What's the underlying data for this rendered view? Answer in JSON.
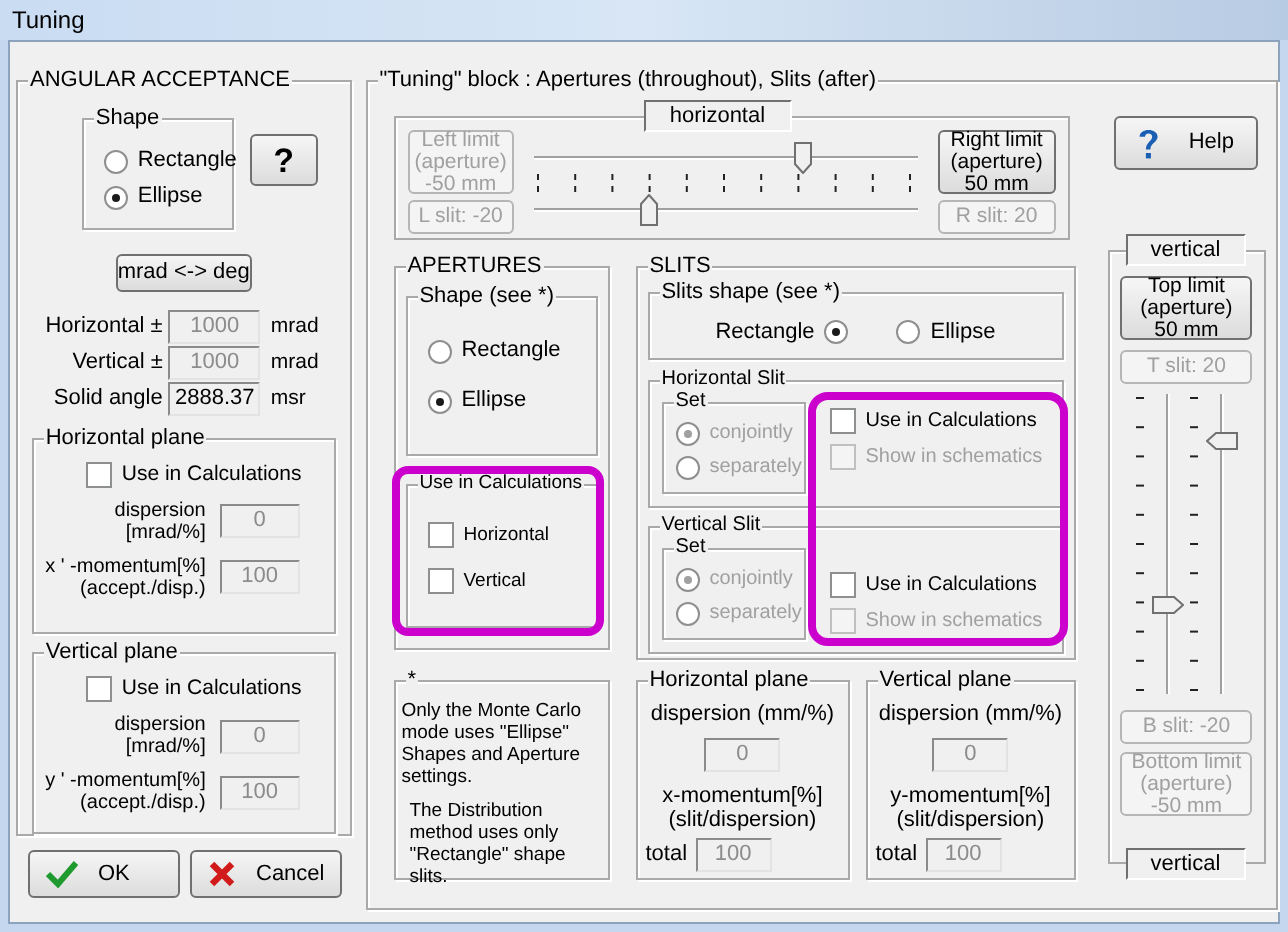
{
  "window": {
    "title": "Tuning"
  },
  "angular_acceptance": {
    "title": "ANGULAR ACCEPTANCE",
    "shape": {
      "title": "Shape",
      "options": [
        {
          "label": "Rectangle",
          "selected": false
        },
        {
          "label": "Ellipse",
          "selected": true
        }
      ]
    },
    "help_button": "?",
    "convert_button": "mrad <-> deg",
    "fields": [
      {
        "label": "Horizontal ±",
        "value": "1000",
        "unit": "mrad",
        "disabled": true
      },
      {
        "label": "Vertical ±",
        "value": "1000",
        "unit": "mrad",
        "disabled": true
      },
      {
        "label": "Solid angle",
        "value": "2888.37",
        "unit": "msr",
        "disabled": false
      }
    ],
    "planes": [
      {
        "title": "Horizontal plane",
        "checkbox": {
          "label": "Use in Calculations",
          "checked": false
        },
        "rows": [
          {
            "label": [
              "dispersion",
              "[mrad/%]"
            ],
            "value": "0",
            "disabled": true
          },
          {
            "label": [
              "x ' -momentum[%]",
              "(accept./disp.)"
            ],
            "value": "100",
            "disabled": true
          }
        ]
      },
      {
        "title": "Vertical plane",
        "checkbox": {
          "label": "Use in Calculations",
          "checked": false
        },
        "rows": [
          {
            "label": [
              "dispersion",
              "[mrad/%]"
            ],
            "value": "0",
            "disabled": true
          },
          {
            "label": [
              "y ' -momentum[%]",
              "(accept./disp.)"
            ],
            "value": "100",
            "disabled": true
          }
        ]
      }
    ]
  },
  "buttons": [
    {
      "kind": "ok",
      "label": "OK"
    },
    {
      "kind": "cancel",
      "label": "Cancel"
    }
  ],
  "tuning_block": {
    "title": "\"Tuning\" block : Apertures (throughout), Slits (after)",
    "horizontal": {
      "caption": "horizontal",
      "limit_low": {
        "lines": [
          "Left limit",
          "(aperture)",
          "-50 mm"
        ],
        "disabled": true
      },
      "slit_low": {
        "label": "L slit: -20",
        "disabled": true
      },
      "limit_high": {
        "lines": [
          "Right limit",
          "(aperture)",
          "50 mm"
        ],
        "disabled": false
      },
      "slit_high": {
        "label": "R slit: 20",
        "disabled": true
      },
      "aperture_slider": {
        "level": 0.7
      },
      "slit_slider": {
        "level": 0.3
      }
    },
    "help_button": "Help",
    "vertical": {
      "caption_top": "vertical",
      "limit_high": {
        "lines": [
          "Top limit",
          "(aperture)",
          "50 mm"
        ],
        "disabled": false
      },
      "slit_high": {
        "label": "T slit: 20",
        "disabled": true
      },
      "slit_slider": {
        "level": 0.3
      },
      "aperture_slider": {
        "level": 0.85
      },
      "slit_low": {
        "label": "B slit: -20",
        "disabled": true
      },
      "limit_low": {
        "lines": [
          "Bottom limit",
          "(aperture)",
          "-50 mm"
        ],
        "disabled": true
      },
      "caption_bottom": "vertical"
    },
    "apertures": {
      "title": "APERTURES",
      "shape": {
        "title": "Shape (see *)",
        "options": [
          {
            "label": "Rectangle",
            "selected": false
          },
          {
            "label": "Ellipse",
            "selected": true
          }
        ]
      },
      "use": {
        "title": "Use in Calculations",
        "highlighted": true,
        "options": [
          {
            "label": "Horizontal",
            "checked": false
          },
          {
            "label": "Vertical",
            "checked": false
          }
        ]
      }
    },
    "slits": {
      "title": "SLITS",
      "shape": {
        "title": "Slits shape (see *)",
        "options": [
          {
            "label": "Rectangle",
            "selected": true
          },
          {
            "label": "Ellipse",
            "selected": false
          }
        ]
      },
      "options_highlighted": true,
      "groups": [
        {
          "title": "Horizontal Slit",
          "set": {
            "title": "Set",
            "options": [
              {
                "label": "conjointly",
                "selected": true,
                "disabled": true
              },
              {
                "label": "separately",
                "selected": false,
                "disabled": true
              }
            ]
          },
          "checks": [
            {
              "label": "Use in Calculations",
              "checked": false,
              "disabled": false
            },
            {
              "label": "Show in schematics",
              "checked": false,
              "disabled": true
            }
          ]
        },
        {
          "title": "Vertical Slit",
          "set": {
            "title": "Set",
            "options": [
              {
                "label": "conjointly",
                "selected": true,
                "disabled": true
              },
              {
                "label": "separately",
                "selected": false,
                "disabled": true
              }
            ]
          },
          "checks": [
            {
              "label": "Use in Calculations",
              "checked": false,
              "disabled": false
            },
            {
              "label": "Show in schematics",
              "checked": false,
              "disabled": true
            }
          ]
        }
      ]
    },
    "note": {
      "title": "*",
      "paragraphs": [
        "Only the Monte Carlo mode uses \"Ellipse\" Shapes and Aperture settings.",
        "The Distribution method uses only  \"Rectangle\" shape slits."
      ]
    },
    "planes": [
      {
        "title": "Horizontal plane",
        "dispersion_label": "dispersion (mm/%)",
        "dispersion": "0",
        "momentum_label": [
          "x-momentum[%]",
          "(slit/dispersion)"
        ],
        "total_label": "total",
        "total": "100"
      },
      {
        "title": "Vertical plane",
        "dispersion_label": "dispersion (mm/%)",
        "dispersion": "0",
        "momentum_label": [
          "y-momentum[%]",
          "(slit/dispersion)"
        ],
        "total_label": "total",
        "total": "100"
      }
    ]
  }
}
